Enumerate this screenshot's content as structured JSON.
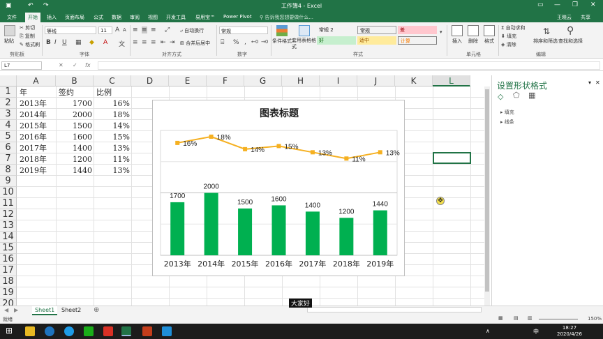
{
  "window": {
    "title": "工作簿4 - Excel",
    "user": "王晓云",
    "share": "共享"
  },
  "tabs": [
    "文件",
    "开始",
    "插入",
    "页面布局",
    "公式",
    "数据",
    "审阅",
    "视图",
    "开发工具",
    "易用宝™",
    "Power Pivot"
  ],
  "tell_me": "告诉我您想要做什么...",
  "ribbon": {
    "paste": "粘贴",
    "cut": "剪切",
    "copy": "复制",
    "format_painter": "格式刷",
    "font_name": "等线",
    "font_size": "11",
    "wrap_text": "自动换行",
    "merge_center": "合并后居中",
    "number_format": "常规",
    "conditional_format": "条件格式",
    "format_as_table": "套用表格格式",
    "styles": [
      {
        "label": "常规 2",
        "bg": "#ffffff",
        "fg": "#000000"
      },
      {
        "label": "常规",
        "bg": "#ffffff",
        "fg": "#000000"
      },
      {
        "label": "差",
        "bg": "#ffc7ce",
        "fg": "#9c0006"
      },
      {
        "label": "好",
        "bg": "#c6efce",
        "fg": "#006100"
      },
      {
        "label": "适中",
        "bg": "#ffeb9c",
        "fg": "#9c5700"
      },
      {
        "label": "计算",
        "bg": "#f2f2f2",
        "fg": "#fa7d00"
      }
    ],
    "insert": "插入",
    "delete": "删除",
    "format": "格式",
    "autosum": "自动求和",
    "fill": "填充",
    "clear": "清除",
    "sort_filter": "排序和筛选",
    "find_select": "查找和选择",
    "groups": [
      "剪贴板",
      "字体",
      "对齐方式",
      "数字",
      "样式",
      "单元格",
      "编辑"
    ]
  },
  "formula_bar": {
    "name_box": "L7",
    "fx": "fx"
  },
  "sheet": {
    "columns": [
      "A",
      "B",
      "C",
      "D",
      "E",
      "F",
      "G",
      "H",
      "I",
      "J",
      "K",
      "L"
    ],
    "selected_column": "L",
    "rows": [
      "1",
      "2",
      "3",
      "4",
      "5",
      "6",
      "7",
      "8",
      "9",
      "10",
      "11",
      "12",
      "13",
      "14",
      "15",
      "16",
      "17",
      "18",
      "19",
      "20"
    ],
    "headers": [
      "年",
      "签约",
      "比例"
    ],
    "data": [
      [
        "2013年",
        "1700",
        "16%"
      ],
      [
        "2014年",
        "2000",
        "18%"
      ],
      [
        "2015年",
        "1500",
        "14%"
      ],
      [
        "2016年",
        "1600",
        "15%"
      ],
      [
        "2017年",
        "1400",
        "13%"
      ],
      [
        "2018年",
        "1200",
        "11%"
      ],
      [
        "2019年",
        "1440",
        "13%"
      ]
    ]
  },
  "chart_data": {
    "type": "bar",
    "title": "图表标题",
    "categories": [
      "2013年",
      "2014年",
      "2015年",
      "2016年",
      "2017年",
      "2018年",
      "2019年"
    ],
    "series": [
      {
        "name": "签约",
        "type": "bar",
        "values": [
          1700,
          2000,
          1500,
          1600,
          1400,
          1200,
          1440
        ],
        "labels": [
          "1700",
          "2000",
          "1500",
          "1600",
          "1400",
          "1200",
          "1440"
        ],
        "color": "#00b050"
      },
      {
        "name": "比例",
        "type": "line",
        "values": [
          0.16,
          0.18,
          0.14,
          0.15,
          0.13,
          0.11,
          0.13
        ],
        "labels": [
          "16%",
          "18%",
          "14%",
          "15%",
          "13%",
          "11%",
          "13%"
        ],
        "color": "#f5b021"
      }
    ],
    "ylim_bars": [
      0,
      4000
    ],
    "ylim_line": [
      -0.2,
      0.2
    ],
    "grid": true,
    "legend": "none"
  },
  "format_pane": {
    "title": "设置形状格式",
    "items": [
      "填充",
      "线条"
    ]
  },
  "sheet_tabs": [
    "Sheet1",
    "Sheet2"
  ],
  "status": {
    "ready": "就绪",
    "zoom": "150%"
  },
  "subtitle": "大家好",
  "taskbar": {
    "time": "18:27",
    "date": "2020/4/26",
    "lang": "中"
  }
}
